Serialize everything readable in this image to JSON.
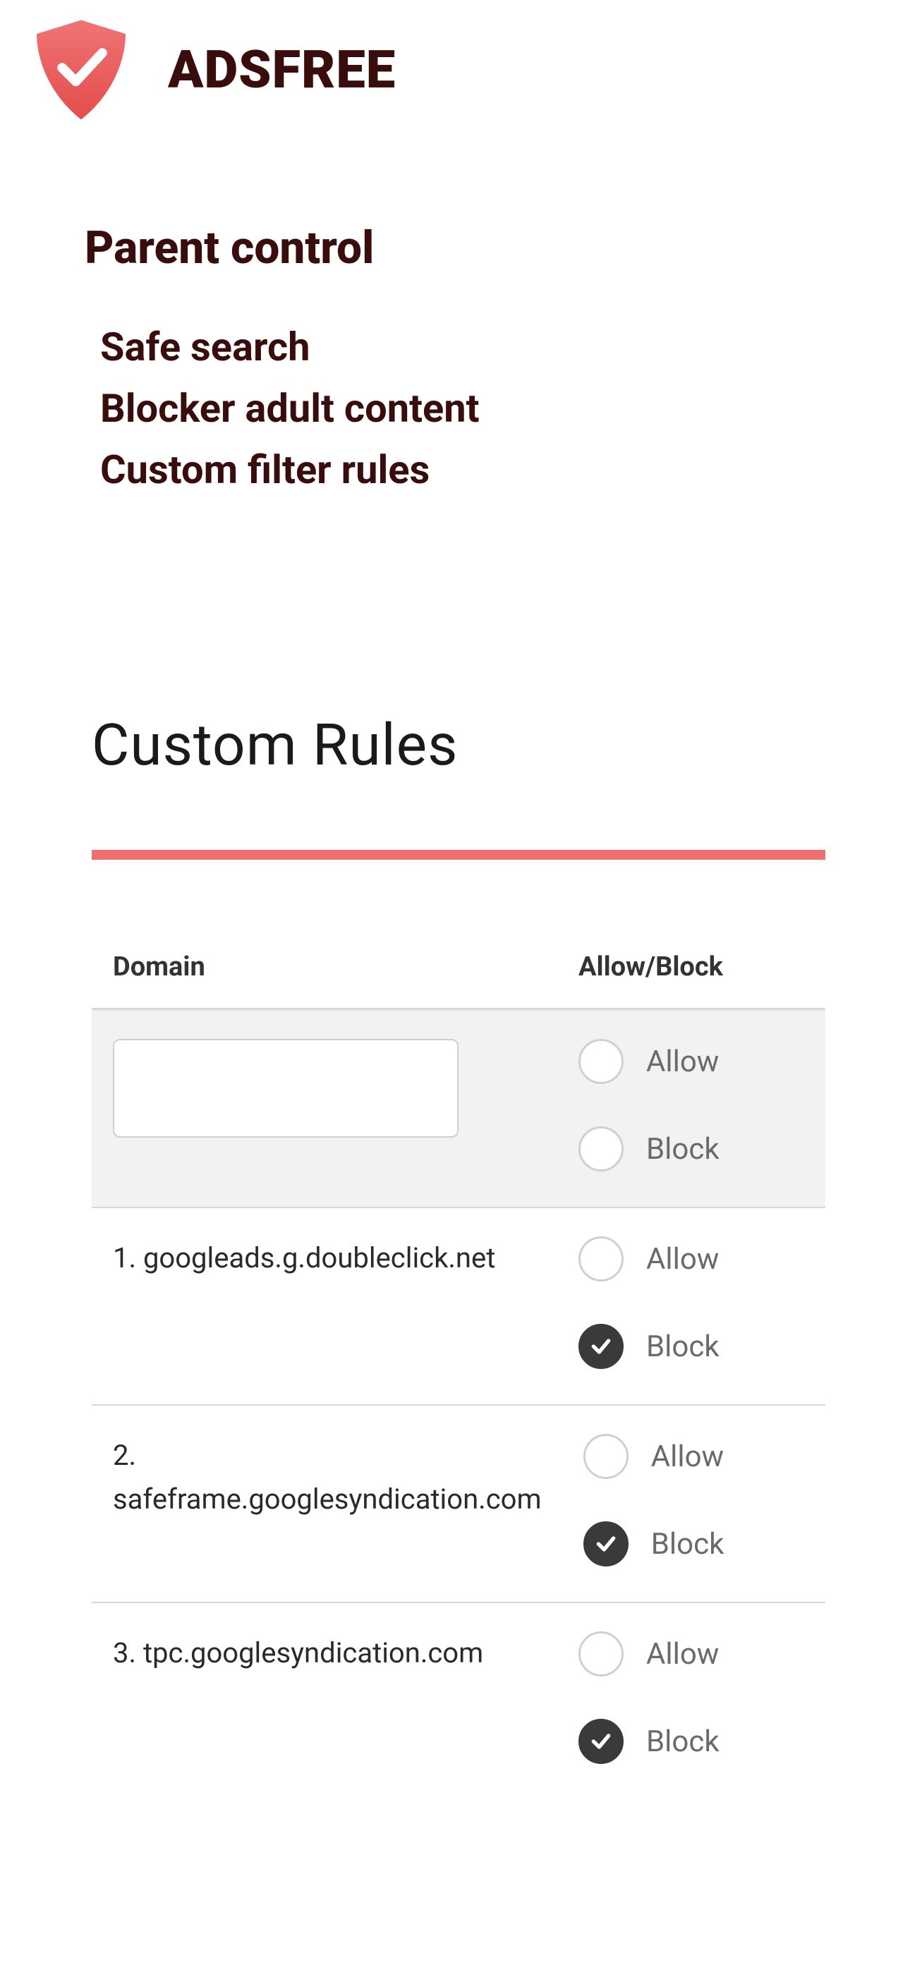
{
  "app": {
    "name": "ADSFREE"
  },
  "parent_control": {
    "title": "Parent control",
    "items": [
      "Safe search",
      "Blocker adult content",
      "Custom filter rules"
    ]
  },
  "custom_rules": {
    "title": "Custom Rules",
    "headers": {
      "domain": "Domain",
      "action": "Allow/Block"
    },
    "radio_labels": {
      "allow": "Allow",
      "block": "Block"
    },
    "new_rule": {
      "domain_value": "",
      "selected": ""
    },
    "rules": [
      {
        "index": "1.",
        "domain": "googleads.g.doubleclick.net",
        "selected": "block"
      },
      {
        "index": "2.",
        "domain": "safeframe.googlesyndication.com",
        "selected": "block"
      },
      {
        "index": "3.",
        "domain": "tpc.googlesyndication.com",
        "selected": "block"
      }
    ]
  }
}
